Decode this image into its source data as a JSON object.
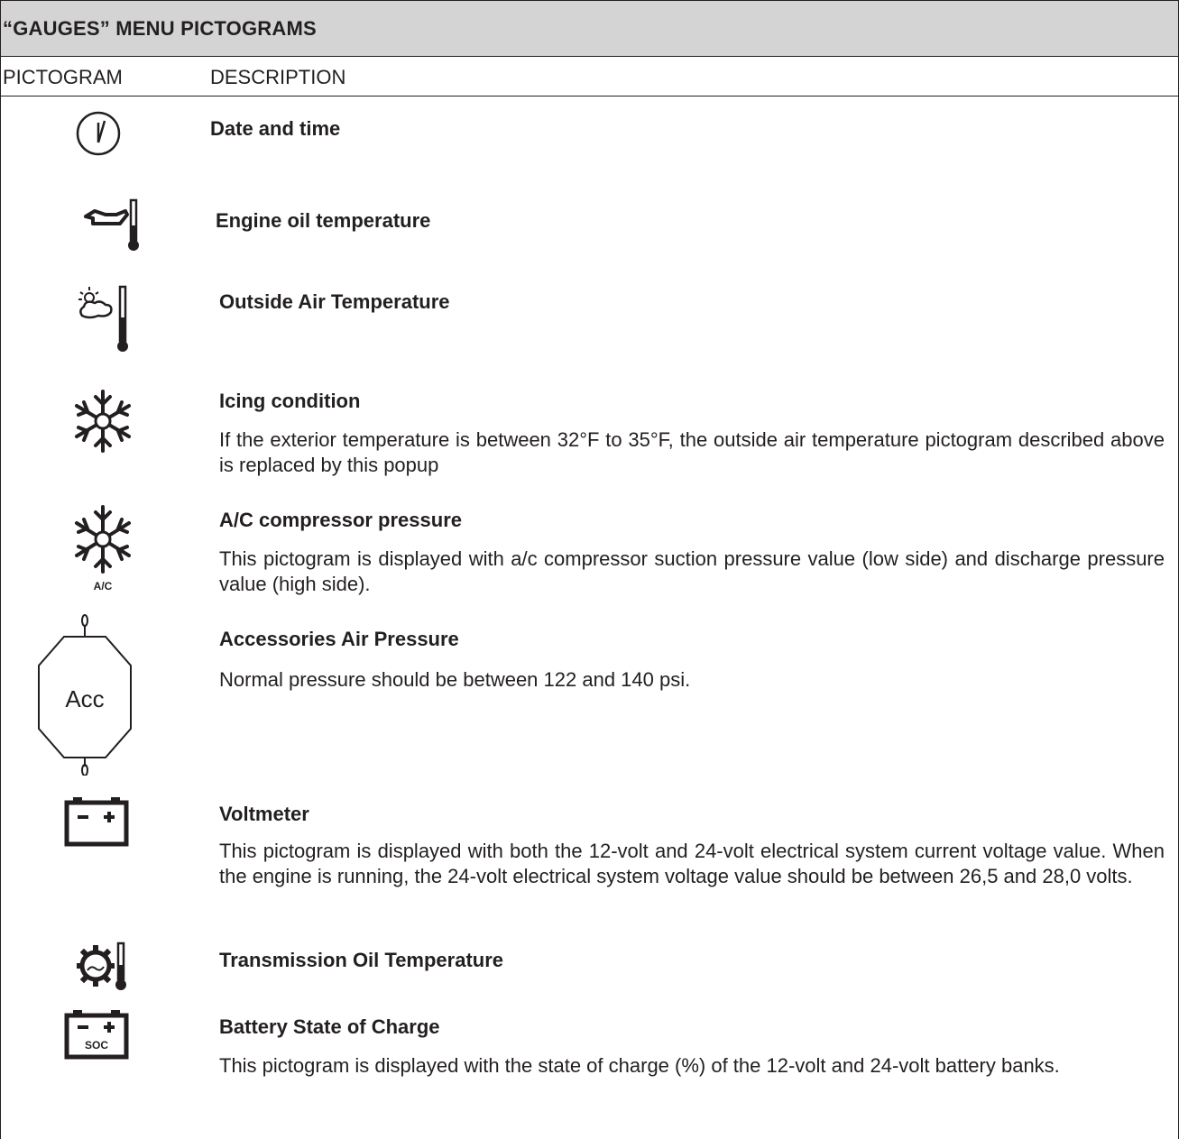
{
  "title": "“GAUGES” MENU PICTOGRAMS",
  "columns": {
    "pictogram": "PICTOGRAM",
    "description": "DESCRIPTION"
  },
  "rows": [
    {
      "icon": "clock-icon",
      "title": "Date and time",
      "description": ""
    },
    {
      "icon": "engine-oil-temperature-icon",
      "title": "Engine oil temperature",
      "description": ""
    },
    {
      "icon": "outside-air-temperature-icon",
      "title": "Outside Air Temperature",
      "description": ""
    },
    {
      "icon": "snowflake-icon",
      "title": "Icing condition",
      "description": "If the exterior temperature is between 32°F to 35°F, the outside air temperature pictogram described above is replaced by this popup"
    },
    {
      "icon": "ac-snowflake-icon",
      "icon_label": "A/C",
      "title": "A/C compressor pressure",
      "description": "This pictogram is displayed with a/c compressor suction pressure value (low side) and discharge pressure value (high side)."
    },
    {
      "icon": "air-tank-icon",
      "icon_label": "Acc",
      "title": "Accessories Air Pressure",
      "description": "Normal pressure should be between 122 and 140 psi."
    },
    {
      "icon": "battery-icon",
      "title": "Voltmeter",
      "description": "This pictogram is displayed with both the 12-volt and 24-volt electrical system current voltage value. When the engine is running, the 24-volt electrical system voltage value should be between 26,5 and 28,0 volts."
    },
    {
      "icon": "transmission-oil-temperature-icon",
      "title": "Transmission Oil Temperature",
      "description": ""
    },
    {
      "icon": "battery-soc-icon",
      "icon_label": "SOC",
      "title": "Battery State of Charge",
      "description": "This pictogram is displayed with the state of charge (%) of the 12-volt and 24-volt battery banks."
    }
  ]
}
